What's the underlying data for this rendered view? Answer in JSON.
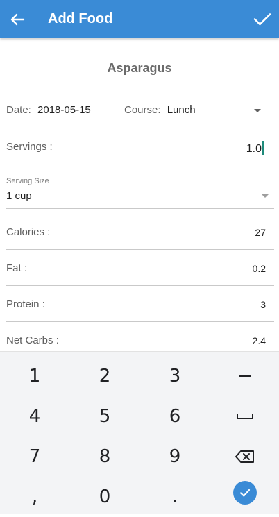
{
  "app_bar": {
    "title": "Add Food",
    "back_icon": "arrow-back-icon",
    "confirm_icon": "check-icon",
    "color": "#3a8bd6"
  },
  "food": {
    "name": "Asparagus"
  },
  "date": {
    "label": "Date:",
    "value": "2018-05-15"
  },
  "course": {
    "label": "Course:",
    "value": "Lunch"
  },
  "servings": {
    "label": "Servings :",
    "value": "1.0"
  },
  "serving_size": {
    "caption": "Serving Size",
    "value": "1 cup"
  },
  "nutrition": [
    {
      "label": "Calories :",
      "value": "27"
    },
    {
      "label": "Fat :",
      "value": "0.2"
    },
    {
      "label": "Protein :",
      "value": "3"
    },
    {
      "label": "Net Carbs :",
      "value": "2.4"
    }
  ],
  "keyboard": {
    "keys": [
      "1",
      "2",
      "3",
      "−",
      "4",
      "5",
      "6",
      "␣",
      "7",
      "8",
      "9",
      "⌫",
      ",",
      "0",
      ".",
      "✓"
    ],
    "enter_color": "#3a8bd6"
  }
}
